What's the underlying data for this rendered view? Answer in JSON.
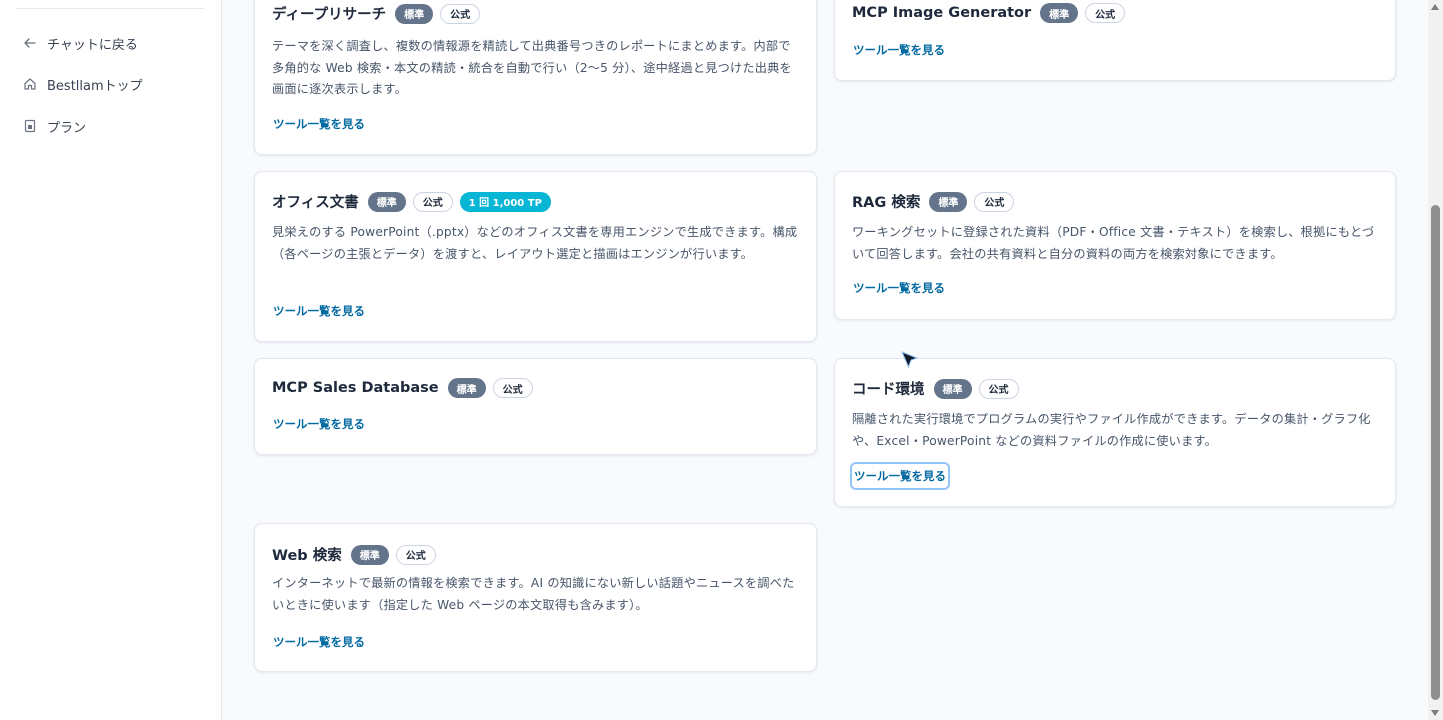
{
  "sidebar": {
    "items": [
      {
        "label": "チャットに戻る",
        "icon": "arrow-left-icon"
      },
      {
        "label": "Bestllamトップ",
        "icon": "home-icon"
      },
      {
        "label": "プラン",
        "icon": "plan-icon"
      }
    ]
  },
  "cards": [
    {
      "title": "ディープリサーチ",
      "badges": [
        "標準",
        "公式"
      ],
      "description": "テーマを深く調査し、複数の情報源を精読して出典番号つきのレポートにまとめます。内部で多角的な Web 検索・本文の精読・統合を自動で行い（2〜5 分）、途中経過と見つけた出典を画面に逐次表示します。",
      "link": "ツール一覧を見る"
    },
    {
      "title": "MCP Image Generator",
      "badges": [
        "標準",
        "公式"
      ],
      "description": "",
      "link": "ツール一覧を見る"
    },
    {
      "title": "オフィス文書",
      "badges": [
        "標準",
        "公式"
      ],
      "cost_badge": "1 回 1,000 TP",
      "description": "見栄えのする PowerPoint（.pptx）などのオフィス文書を専用エンジンで生成できます。構成（各ページの主張とデータ）を渡すと、レイアウト選定と描画はエンジンが行います。",
      "link": "ツール一覧を見る"
    },
    {
      "title": "RAG 検索",
      "badges": [
        "標準",
        "公式"
      ],
      "description": "ワーキングセットに登録された資料（PDF・Office 文書・テキスト）を検索し、根拠にもとづいて回答します。会社の共有資料と自分の資料の両方を検索対象にできます。",
      "link": "ツール一覧を見る"
    },
    {
      "title": "MCP Sales Database",
      "badges": [
        "標準",
        "公式"
      ],
      "description": "",
      "link": "ツール一覧を見る"
    },
    {
      "title": "コード環境",
      "badges": [
        "標準",
        "公式"
      ],
      "description": "隔離された実行環境でプログラムの実行やファイル作成ができます。データの集計・グラフ化や、Excel・PowerPoint などの資料ファイルの作成に使います。",
      "link": "ツール一覧を見る"
    },
    {
      "title": "Web 検索",
      "badges": [
        "標準",
        "公式"
      ],
      "description": "インターネットで最新の情報を検索できます。AI の知識にない新しい話題やニュースを調べたいときに使います（指定した Web ページの本文取得も含みます）。",
      "link": "ツール一覧を見る"
    }
  ],
  "colors": {
    "badge_standard": "#64748b",
    "badge_cost": "#06b6d4",
    "link": "#0369a1"
  }
}
